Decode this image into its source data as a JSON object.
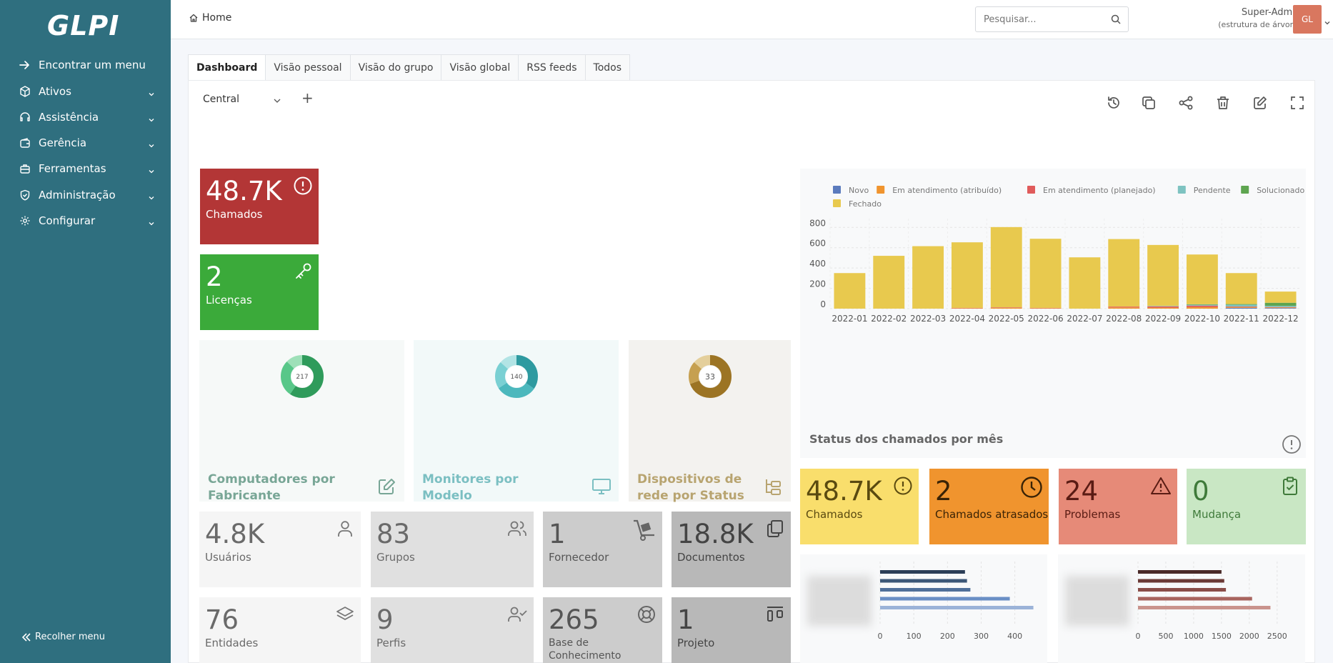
{
  "sidebar": {
    "logo": "GLPI",
    "items": [
      {
        "label": "Encontrar um menu",
        "icon": "arrow-right-icon",
        "chevron": false
      },
      {
        "label": "Ativos",
        "icon": "box-icon",
        "chevron": true
      },
      {
        "label": "Assistência",
        "icon": "headset-icon",
        "chevron": true
      },
      {
        "label": "Gerência",
        "icon": "wallet-icon",
        "chevron": true
      },
      {
        "label": "Ferramentas",
        "icon": "briefcase-icon",
        "chevron": true
      },
      {
        "label": "Administração",
        "icon": "shield-icon",
        "chevron": true
      },
      {
        "label": "Configurar",
        "icon": "gear-icon",
        "chevron": true
      }
    ],
    "collapse_label": "Recolher menu"
  },
  "header": {
    "home_label": "Home",
    "search_placeholder": "Pesquisar...",
    "user_name": "Super-Admin",
    "user_entity": "(estrutura de árvore)",
    "avatar_initials": "GL"
  },
  "tabs": [
    "Dashboard",
    "Visão pessoal",
    "Visão do grupo",
    "Visão global",
    "RSS feeds",
    "Todos"
  ],
  "dashboard": {
    "selected": "Central",
    "add_label": "+"
  },
  "cards": {
    "chamados_red": {
      "value": "48.7K",
      "label": "Chamados"
    },
    "licencas": {
      "value": "2",
      "label": "Licenças"
    },
    "usuarios": {
      "value": "4.8K",
      "label": "Usuários"
    },
    "grupos": {
      "value": "83",
      "label": "Grupos"
    },
    "fornecedor": {
      "value": "1",
      "label": "Fornecedor"
    },
    "documentos": {
      "value": "18.8K",
      "label": "Documentos"
    },
    "entidades": {
      "value": "76",
      "label": "Entidades"
    },
    "perfis": {
      "value": "9",
      "label": "Perfis"
    },
    "base": {
      "value": "265",
      "label": "Base de Conhecimento"
    },
    "projeto": {
      "value": "1",
      "label": "Projeto"
    },
    "chamados_yellow": {
      "value": "48.7K",
      "label": "Chamados"
    },
    "atrasados": {
      "value": "2",
      "label": "Chamados atrasados"
    },
    "problemas": {
      "value": "24",
      "label": "Problemas"
    },
    "mudanca": {
      "value": "0",
      "label": "Mudança"
    }
  },
  "pies": {
    "computadores": {
      "total": "217",
      "title": "Computadores por Fabricante"
    },
    "monitores": {
      "total": "140",
      "title": "Monitores por Modelo"
    },
    "dispositivos": {
      "total": "33",
      "title": "Dispositivos de rede por Status"
    }
  },
  "colors": {
    "sidebar": "#2f6f7f",
    "red_card": "#b33636",
    "green_card": "#3baa3a",
    "yellow_card": "#f9de6c",
    "orange_card": "#f0942e",
    "salmon_card": "#e68a78",
    "lightgreen_card": "#c9e7c4"
  },
  "chart_data": [
    {
      "type": "bar",
      "title": "Status dos chamados por mês",
      "categories": [
        "2022-01",
        "2022-02",
        "2022-03",
        "2022-04",
        "2022-05",
        "2022-06",
        "2022-07",
        "2022-08",
        "2022-09",
        "2022-10",
        "2022-11",
        "2022-12"
      ],
      "series": [
        {
          "name": "Novo",
          "color": "#5b7bbd",
          "values": [
            0,
            0,
            0,
            0,
            0,
            0,
            0,
            0,
            0,
            0,
            8,
            6
          ]
        },
        {
          "name": "Em atendimento (atribuído)",
          "color": "#f0942e",
          "values": [
            0,
            0,
            0,
            5,
            8,
            5,
            0,
            12,
            10,
            15,
            8,
            6
          ]
        },
        {
          "name": "Em atendimento (planejado)",
          "color": "#e05b5b",
          "values": [
            0,
            0,
            0,
            3,
            5,
            3,
            0,
            8,
            12,
            15,
            5,
            4
          ]
        },
        {
          "name": "Pendente",
          "color": "#7ec3c1",
          "values": [
            0,
            0,
            0,
            0,
            0,
            0,
            0,
            0,
            5,
            8,
            18,
            12
          ]
        },
        {
          "name": "Solucionado",
          "color": "#5ea550",
          "values": [
            0,
            0,
            0,
            0,
            0,
            0,
            0,
            0,
            0,
            5,
            6,
            30
          ]
        },
        {
          "name": "Fechado",
          "color": "#e8c94e",
          "values": [
            350,
            520,
            615,
            645,
            790,
            680,
            505,
            665,
            600,
            490,
            305,
            110
          ]
        }
      ],
      "yticks": [
        0,
        200,
        400,
        600,
        800
      ],
      "ylim": [
        0,
        830
      ]
    },
    {
      "type": "bar",
      "orientation": "horizontal",
      "xticks": [
        0,
        100,
        200,
        300,
        400
      ],
      "series": [
        {
          "color": "#2c3e57",
          "values": [
            252
          ]
        },
        {
          "color": "#3c5777",
          "values": [
            258
          ]
        },
        {
          "color": "#4f6f99",
          "values": [
            268
          ]
        },
        {
          "color": "#6a8fc5",
          "values": [
            385
          ]
        },
        {
          "color": "#9bb3d8",
          "values": [
            455
          ]
        }
      ]
    },
    {
      "type": "bar",
      "orientation": "horizontal",
      "xticks": [
        0,
        500,
        1000,
        1500,
        2000,
        2500
      ],
      "series": [
        {
          "color": "#4a2a28",
          "values": [
            1500
          ]
        },
        {
          "color": "#6b3a36",
          "values": [
            1550
          ]
        },
        {
          "color": "#8a4d48",
          "values": [
            1580
          ]
        },
        {
          "color": "#a8645e",
          "values": [
            2050
          ]
        },
        {
          "color": "#c9938d",
          "values": [
            2380
          ]
        }
      ]
    }
  ]
}
